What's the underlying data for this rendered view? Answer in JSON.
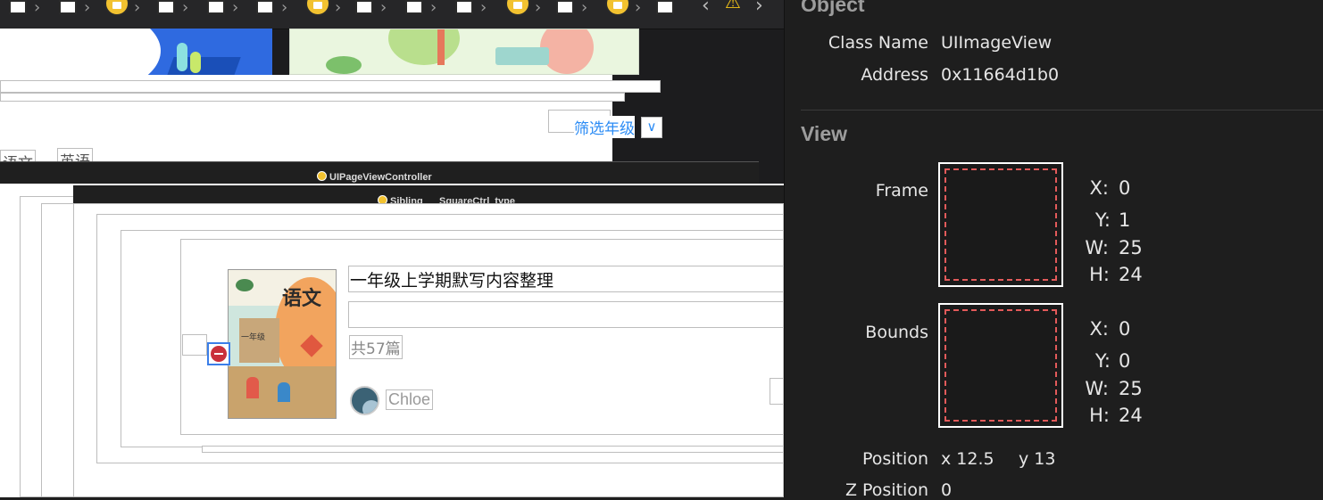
{
  "canvas": {
    "tabs": [
      "语文",
      "英语"
    ],
    "filter_label": "筛选年级",
    "filter_icon": "chevron-down-icon",
    "layer_labels": [
      "UIPageViewController",
      "Sibling___SquareCtrl_type"
    ],
    "cell": {
      "title": "一年级上学期默写内容整理",
      "count": "共57篇",
      "author": "Chloe",
      "cover_title": "语文",
      "cover_grade": "一年级"
    }
  },
  "inspector": {
    "object_section": "Object",
    "class_name_label": "Class Name",
    "class_name_value": "UIImageView",
    "address_label": "Address",
    "address_value": "0x11664d1b0",
    "view_section": "View",
    "frame": {
      "label": "Frame",
      "x_label": "X:",
      "x": "0",
      "y_label": "Y:",
      "y": "1",
      "w_label": "W:",
      "w": "25",
      "h_label": "H:",
      "h": "24"
    },
    "bounds": {
      "label": "Bounds",
      "x_label": "X:",
      "x": "0",
      "y_label": "Y:",
      "y": "0",
      "w_label": "W:",
      "w": "25",
      "h_label": "H:",
      "h": "24"
    },
    "position": {
      "label": "Position",
      "x": "x 12.5",
      "y": "y 13"
    },
    "z_position": {
      "label": "Z Position",
      "value": "0"
    }
  },
  "colors": {
    "canvas_bg": "#1c1c1e",
    "inspector_bg": "#1e1e1e",
    "filter_blue": "#2c8cf5",
    "dash_red": "#e25a5a",
    "warning_yellow": "#f5c518"
  }
}
